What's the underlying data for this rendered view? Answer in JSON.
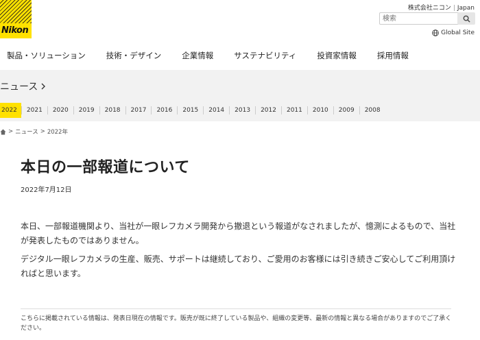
{
  "brand": {
    "logo_text": "Nikon"
  },
  "header": {
    "corp_name": "株式会社ニコン",
    "region": "Japan",
    "search_placeholder": "検索",
    "global_site": "Global Site"
  },
  "nav": [
    "製品・ソリューション",
    "技術・デザイン",
    "企業情報",
    "サステナビリティ",
    "投資家情報",
    "採用情報"
  ],
  "section": {
    "title": "ニュース"
  },
  "years": [
    "2022",
    "2021",
    "2020",
    "2019",
    "2018",
    "2017",
    "2016",
    "2015",
    "2014",
    "2013",
    "2012",
    "2011",
    "2010",
    "2009",
    "2008"
  ],
  "breadcrumb": {
    "news": "ニュース",
    "year": "2022年"
  },
  "article": {
    "title": "本日の一部報道について",
    "date": "2022年7月12日",
    "paragraph1": "本日、一部報道機関より、当社が一眼レフカメラ開発から撤退という報道がなされましたが、憶測によるもので、当社が発表したものではありません。",
    "paragraph2": "デジタル一眼レフカメラの生産、販売、サポートは継続しており、ご愛用のお客様には引き続きご安心してご利用頂ければと思います。"
  },
  "footer_note": "こちらに掲載されている情報は、発表日現在の情報です。販売が既に終了している製品や、組織の変更等、最新の情報と異なる場合がありますのでご了承ください。",
  "colors": {
    "brand_yellow": "#ffe100",
    "band_gray": "#f2f2f2"
  },
  "icons": [
    "search-icon",
    "globe-icon",
    "chevron-right-icon",
    "home-icon"
  ]
}
